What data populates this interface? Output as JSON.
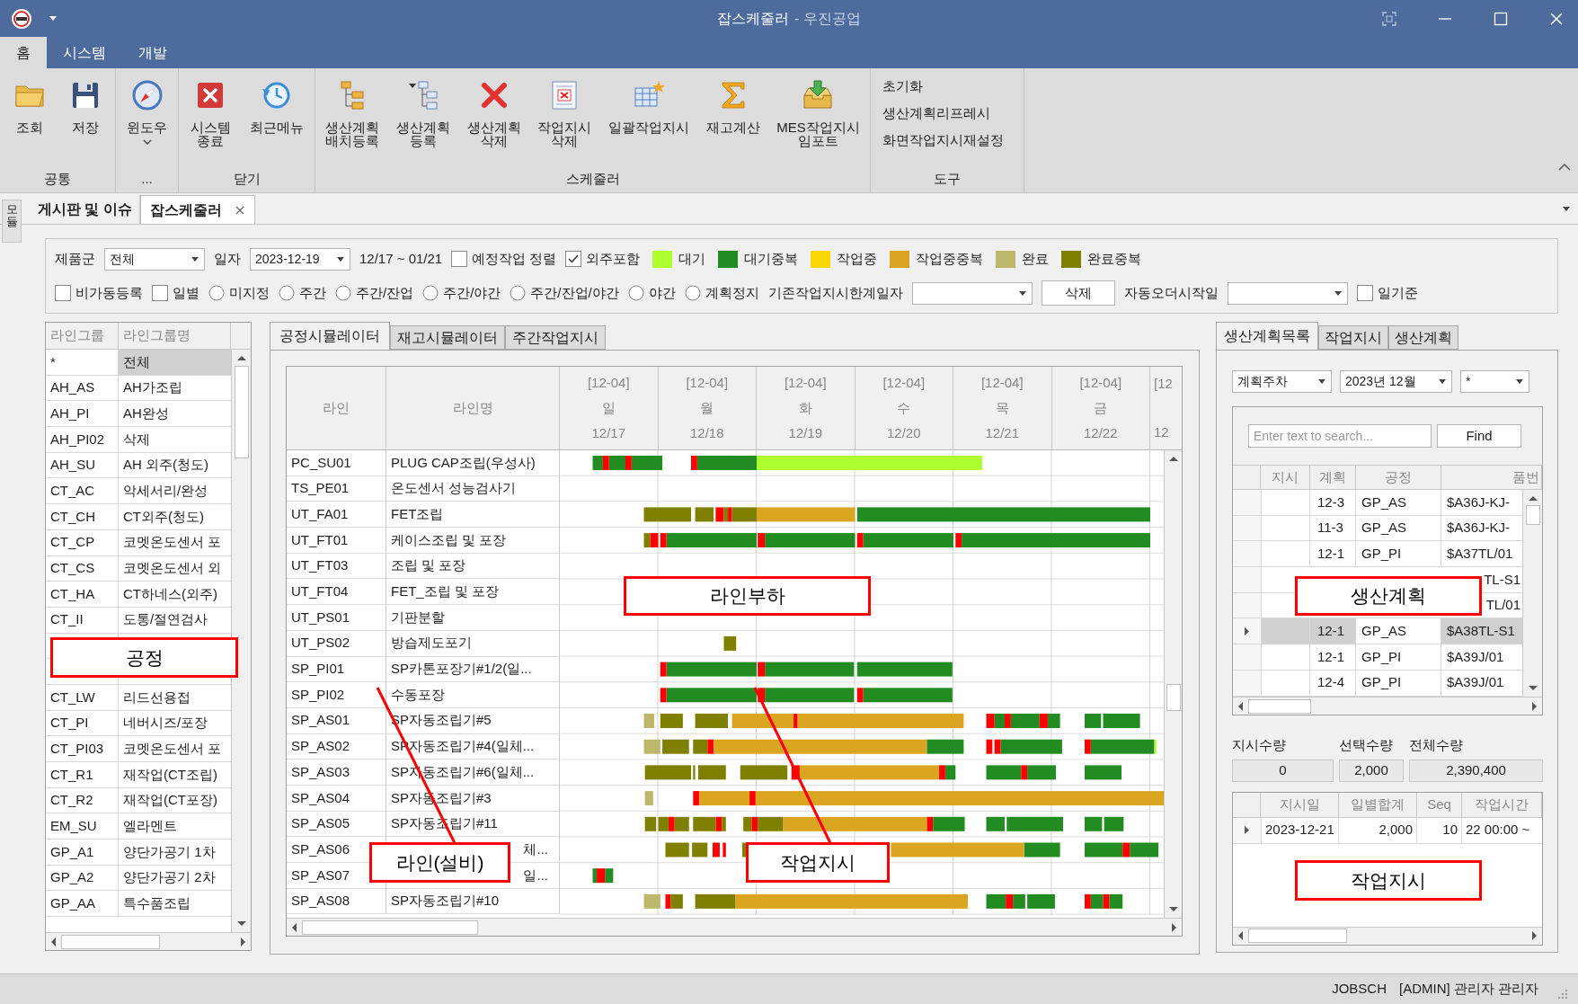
{
  "window": {
    "title": "잡스케줄러",
    "subtitle": "- 우진공업"
  },
  "ribbon": {
    "tabs": [
      {
        "label": "홈",
        "selected": true
      },
      {
        "label": "시스템",
        "selected": false
      },
      {
        "label": "개발",
        "selected": false
      }
    ],
    "groups": [
      {
        "label": "공통",
        "buttons": [
          {
            "label": "조회",
            "dropdown": false
          },
          {
            "label": "저장",
            "dropdown": false
          }
        ]
      },
      {
        "label": "...",
        "buttons": [
          {
            "label": "윈도우",
            "dropdown": true
          }
        ]
      },
      {
        "label": "닫기",
        "buttons": [
          {
            "label": "시스템\n종료",
            "dropdown": false
          },
          {
            "label": "최근메뉴",
            "dropdown": false
          }
        ]
      },
      {
        "label": "스케줄러",
        "buttons": [
          {
            "label": "생산계획\n배치등록",
            "dropdown": false
          },
          {
            "label": "생산계획\n등록",
            "dropdown": false
          },
          {
            "label": "생산계획\n삭제",
            "dropdown": false
          },
          {
            "label": "작업지시\n삭제",
            "dropdown": false
          },
          {
            "label": "일괄작업지시",
            "dropdown": false
          },
          {
            "label": "재고계산",
            "dropdown": false
          },
          {
            "label": "MES작업지시\n임포트",
            "dropdown": false
          }
        ]
      },
      {
        "label": "도구",
        "links": [
          "초기화",
          "생산계획리프레시",
          "화면작업지시재설정"
        ]
      }
    ]
  },
  "doc_tabs": {
    "side_tab": "모듈",
    "tabs": [
      {
        "label": "게시판 및 이슈",
        "selected": false,
        "closable": false
      },
      {
        "label": "잡스케줄러",
        "selected": true,
        "closable": true
      }
    ]
  },
  "filters": [
    [
      {
        "kind": "label",
        "text": "제품군"
      },
      {
        "kind": "select",
        "value": "전체"
      },
      {
        "kind": "label",
        "text": "일자"
      },
      {
        "kind": "select",
        "value": "2023-12-19"
      },
      {
        "kind": "label",
        "text": "12/17 ~ 01/21"
      },
      {
        "kind": "checkbox",
        "label": "예정작업 정렬",
        "checked": false
      },
      {
        "kind": "checkbox",
        "label": "외주포함",
        "checked": true
      },
      {
        "kind": "legend",
        "label": "대기",
        "color": "#adff2f"
      },
      {
        "kind": "legend",
        "label": "대기중복",
        "color": "#228b22"
      },
      {
        "kind": "legend",
        "label": "작업중",
        "color": "#ffd700"
      },
      {
        "kind": "legend",
        "label": "작업중중복",
        "color": "#daa520"
      },
      {
        "kind": "legend",
        "label": "완료",
        "color": "#bdb76b"
      },
      {
        "kind": "legend",
        "label": "완료중복",
        "color": "#808000"
      }
    ],
    [
      {
        "kind": "checkbox",
        "label": "비가동등록",
        "checked": false
      },
      {
        "kind": "checkbox",
        "label": "일별",
        "checked": false
      },
      {
        "kind": "radio",
        "label": "미지정",
        "selected": false
      },
      {
        "kind": "radio",
        "label": "주간",
        "selected": false
      },
      {
        "kind": "radio",
        "label": "주간/잔업",
        "selected": false
      },
      {
        "kind": "radio",
        "label": "주간/야간",
        "selected": false
      },
      {
        "kind": "radio",
        "label": "주간/잔업/야간",
        "selected": false
      },
      {
        "kind": "radio",
        "label": "야간",
        "selected": false
      },
      {
        "kind": "radio",
        "label": "계획정지",
        "selected": false
      },
      {
        "kind": "label",
        "text": "기존작업지시한계일자"
      },
      {
        "kind": "select"
      },
      {
        "kind": "button",
        "label": "삭제"
      },
      {
        "kind": "label",
        "text": "자동오더시작일"
      },
      {
        "kind": "select"
      },
      {
        "kind": "checkbox",
        "label": "일기준",
        "checked": false
      }
    ]
  ],
  "line_groups": {
    "columns": [
      "라인그룹",
      "라인그룹명"
    ],
    "rows": [
      {
        "kind": "row",
        "code": "*",
        "name": "전체",
        "selected": true
      },
      {
        "kind": "row",
        "code": "AH_AS",
        "name": "AH가조립",
        "selected": false
      },
      {
        "kind": "row",
        "code": "AH_PI",
        "name": "AH완성",
        "selected": false
      },
      {
        "kind": "row",
        "code": "AH_PI02",
        "name": "삭제",
        "selected": false
      },
      {
        "kind": "row",
        "code": "AH_SU",
        "name": "AH 외주(청도)",
        "selected": false
      },
      {
        "kind": "row",
        "code": "CT_AC",
        "name": "악세서리/완성",
        "selected": false
      },
      {
        "kind": "row",
        "code": "CT_CH",
        "name": "CT외주(청도)",
        "selected": false
      },
      {
        "kind": "row",
        "code": "CT_CP",
        "name": "코멧온도센서 포",
        "selected": false
      },
      {
        "kind": "row",
        "code": "CT_CS",
        "name": "코멧온도센서 외",
        "selected": false
      },
      {
        "kind": "row",
        "code": "CT_HA",
        "name": "CT하네스(외주)",
        "selected": false
      },
      {
        "kind": "row",
        "code": "CT_II",
        "name": "도통/절연검사",
        "selected": false
      },
      {
        "kind": "covered"
      },
      {
        "kind": "covered"
      },
      {
        "kind": "row",
        "code": "CT_LW",
        "name": "리드선용접",
        "selected": false
      },
      {
        "kind": "row",
        "code": "CT_PI",
        "name": "네버시즈/포장",
        "selected": false
      },
      {
        "kind": "row",
        "code": "CT_PI03",
        "name": "코멧온도센서 포",
        "selected": false
      },
      {
        "kind": "row",
        "code": "CT_R1",
        "name": "재작업(CT조립)",
        "selected": false
      },
      {
        "kind": "row",
        "code": "CT_R2",
        "name": "재작업(CT포장)",
        "selected": false
      },
      {
        "kind": "row",
        "code": "EM_SU",
        "name": "엘라멘트",
        "selected": false
      },
      {
        "kind": "row",
        "code": "GP_A1",
        "name": "양단가공기 1차",
        "selected": false
      },
      {
        "kind": "row",
        "code": "GP_A2",
        "name": "양단가공기 2차",
        "selected": false
      },
      {
        "kind": "row",
        "code": "GP_AA",
        "name": "특수품조립",
        "selected": false
      }
    ]
  },
  "center_tabs": [
    {
      "label": "공정시뮬레이터",
      "selected": true
    },
    {
      "label": "재고시뮬레이터",
      "selected": false
    },
    {
      "label": "주간작업지시",
      "selected": false
    }
  ],
  "gantt": {
    "columns": [
      "라인",
      "라인명"
    ],
    "days": [
      {
        "week": "[12-04]",
        "weekday": "일",
        "date": "12/17"
      },
      {
        "week": "[12-04]",
        "weekday": "월",
        "date": "12/18"
      },
      {
        "week": "[12-04]",
        "weekday": "화",
        "date": "12/19"
      },
      {
        "week": "[12-04]",
        "weekday": "수",
        "date": "12/20"
      },
      {
        "week": "[12-04]",
        "weekday": "목",
        "date": "12/21"
      },
      {
        "week": "[12-04]",
        "weekday": "금",
        "date": "12/22"
      },
      {
        "week": "[12",
        "date": "12"
      }
    ],
    "rows": [
      {
        "kind": "row",
        "line": "PC_SU01",
        "name": "PLUG CAP조립(우성사)"
      },
      {
        "kind": "row",
        "line": "TS_PE01",
        "name": "온도센서 성능검사기"
      },
      {
        "kind": "row",
        "line": "UT_FA01",
        "name": "FET조립"
      },
      {
        "kind": "row",
        "line": "UT_FT01",
        "name": "케이스조립 및 포장"
      },
      {
        "kind": "row",
        "line": "UT_FT03",
        "name": "조립 및 포장"
      },
      {
        "kind": "row",
        "line": "UT_FT04",
        "name": "FET_조립 및 포장"
      },
      {
        "kind": "row",
        "line": "UT_PS01",
        "name": "기판분할"
      },
      {
        "kind": "row",
        "line": "UT_PS02",
        "name": "방습제도포기"
      },
      {
        "kind": "row",
        "line": "SP_PI01",
        "name": "SP카톤포장기#1/2(일..."
      },
      {
        "kind": "row",
        "line": "SP_PI02",
        "name": "수동포장"
      },
      {
        "kind": "row",
        "line": "SP_AS01",
        "name": "SP자동조립기#5"
      },
      {
        "kind": "row",
        "line": "SP_AS02",
        "name": "SP자동조립기#4(일체..."
      },
      {
        "kind": "row",
        "line": "SP_AS03",
        "name": "SP자동조립기#6(일체..."
      },
      {
        "kind": "row",
        "line": "SP_AS04",
        "name": "SP자동조립기#3"
      },
      {
        "kind": "row",
        "line": "SP_AS05",
        "name": "SP자동조립기#11"
      },
      {
        "kind": "clipped",
        "line": "SP_AS06",
        "name": "체..."
      },
      {
        "kind": "clipped",
        "line": "SP_AS07",
        "name": "일..."
      },
      {
        "kind": "row",
        "line": "SP_AS08",
        "name": "SP자동조립기#10"
      }
    ]
  },
  "right_tabs": [
    {
      "label": "생산계획목록",
      "selected": true
    },
    {
      "label": "작업지시",
      "selected": false
    },
    {
      "label": "생산계획",
      "selected": false
    }
  ],
  "plan_filters": [
    {
      "value": "계획주차"
    },
    {
      "value": "2023년 12월"
    },
    {
      "value": "*"
    }
  ],
  "plan_search": {
    "placeholder": "Enter text to search...",
    "button": "Find"
  },
  "plan_grid": {
    "columns": [
      "지시",
      "계획",
      "공정",
      "품번"
    ],
    "rows": [
      {
        "kind": "row",
        "plan": "12-3",
        "process": "GP_AS",
        "part": "$A36J-KJ-",
        "selected": false
      },
      {
        "kind": "row",
        "plan": "11-3",
        "process": "GP_AS",
        "part": "$A36J-KJ-",
        "selected": false
      },
      {
        "kind": "row",
        "plan": "12-1",
        "process": "GP_PI",
        "part": "$A37TL/01",
        "selected": false
      },
      {
        "kind": "covered",
        "part": "TL-S1",
        "selected": false
      },
      {
        "kind": "covered",
        "part": "TL/01",
        "selected": false
      },
      {
        "kind": "row",
        "plan": "12-1",
        "process": "GP_AS",
        "part": "$A38TL-S1",
        "selected": true
      },
      {
        "kind": "row",
        "plan": "12-1",
        "process": "GP_PI",
        "part": "$A39J/01",
        "selected": false
      },
      {
        "kind": "row",
        "plan": "12-4",
        "process": "GP_PI",
        "part": "$A39J/01",
        "selected": false
      }
    ]
  },
  "quantities": [
    {
      "label": "지시수량",
      "value": "0"
    },
    {
      "label": "선택수량",
      "value": "2,000"
    },
    {
      "label": "전체수량",
      "value": "2,390,400"
    }
  ],
  "order_grid": {
    "columns": [
      "지시일",
      "일별합계",
      "Seq",
      "작업시간"
    ],
    "rows": [
      {
        "date": "2023-12-21",
        "total": "2,000",
        "seq": "10",
        "time": "22 00:00 ~",
        "selected": true
      }
    ]
  },
  "callouts": [
    "공정",
    "라인부하",
    "생산계획",
    "라인(설비)",
    "작업지시",
    "작업지시"
  ],
  "status_bar": {
    "program": "JOBSCH",
    "user": "[ADMIN] 관리자 관리자"
  }
}
